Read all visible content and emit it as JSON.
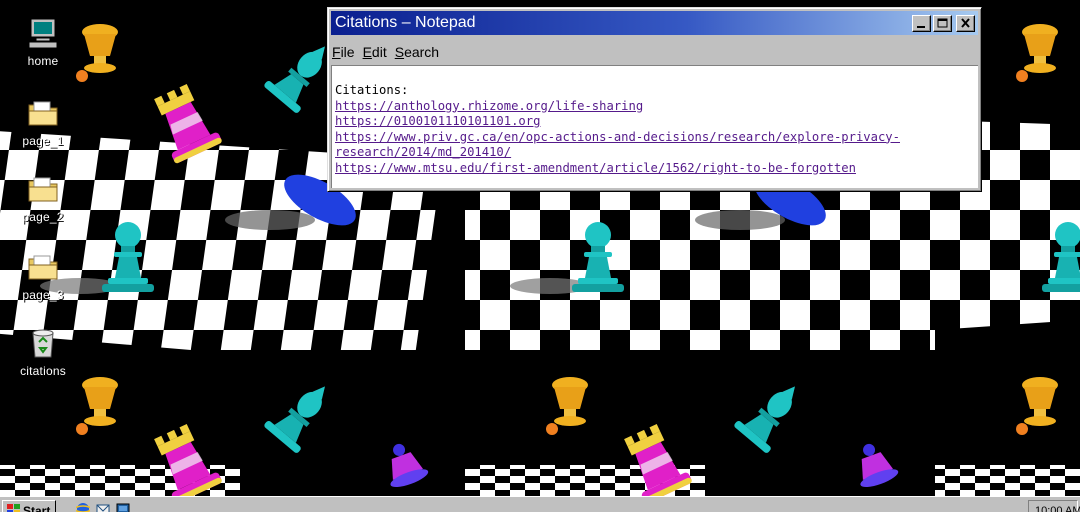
{
  "desktop": {
    "icons": [
      {
        "label": "home",
        "icon": "computer-icon"
      },
      {
        "label": "page_1",
        "icon": "folder-icon"
      },
      {
        "label": "page_2",
        "icon": "folder-icon"
      },
      {
        "label": "page_3",
        "icon": "folder-icon"
      },
      {
        "label": "citations",
        "icon": "recycle-bin-icon"
      }
    ]
  },
  "window": {
    "title": "Citations – Notepad",
    "controls": {
      "minimize": "minimize-icon",
      "maximize": "maximize-icon",
      "close": "close-icon"
    },
    "menu": {
      "file": {
        "accel": "F",
        "rest": "ile"
      },
      "edit": {
        "accel": "E",
        "rest": "dit"
      },
      "search": {
        "accel": "S",
        "rest": "earch"
      }
    },
    "content": {
      "heading": "Citations:",
      "links": [
        "https://anthology.rhizome.org/life-sharing",
        "https://0100101110101101.org",
        "https://www.priv.gc.ca/en/opc-actions-and-decisions/research/explore-privacy-",
        "research/2014/md_201410/",
        "https://www.mtsu.edu/first-amendment/article/1562/right-to-be-forgotten"
      ]
    }
  },
  "taskbar": {
    "start_label": "Start",
    "quick_launch": [
      "internet-explorer-icon",
      "outlook-express-icon",
      "show-desktop-icon"
    ],
    "clock": "10:00 AM"
  },
  "colors": {
    "desktop": "#000000",
    "titlebar_start": "#0a1f8f",
    "titlebar_end": "#a6caf0",
    "chrome": "#c0c0c0",
    "link": "#551a8b",
    "piece_cyan": "#1fc4c4",
    "piece_magenta": "#e020c8",
    "piece_gold": "#f0b020",
    "piece_blue": "#2040e0"
  }
}
